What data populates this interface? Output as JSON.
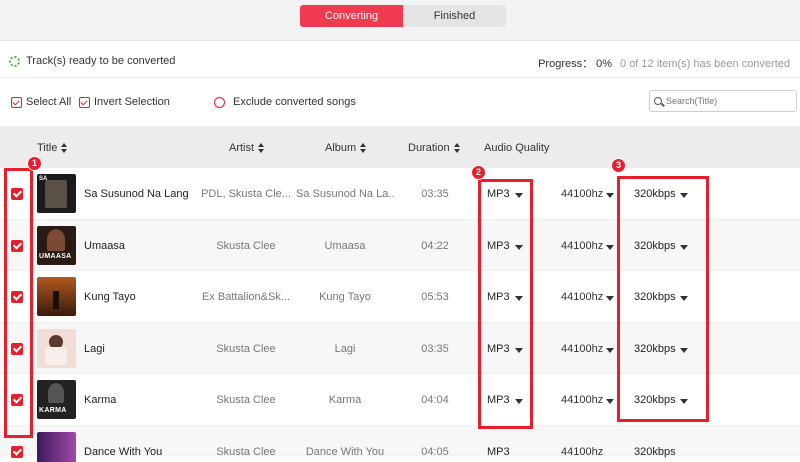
{
  "tabs": [
    {
      "label": "Converting",
      "active": true
    },
    {
      "label": "Finished",
      "active": false
    }
  ],
  "status": {
    "text": "Track(s) ready to be converted",
    "progress_label": "Progress：",
    "progress_value": "0%",
    "progress_count": "0 of 12 item(s) has been converted"
  },
  "toolbar": {
    "select_all": "Select All",
    "invert_selection": "Invert Selection",
    "exclude_converted": "Exclude converted songs",
    "search_placeholder": "Search(Title)"
  },
  "columns": {
    "title": "Title",
    "artist": "Artist",
    "album": "Album",
    "duration": "Duration",
    "audio_quality": "Audio Quality"
  },
  "annotations": [
    "1",
    "2",
    "3"
  ],
  "tracks": [
    {
      "title": "Sa Susunod Na Lang",
      "artist": "PDL, Skusta Cle...",
      "album": "Sa Susunod Na La...",
      "duration": "03:35",
      "format": "MP3",
      "sample_rate": "44100hz",
      "bitrate": "320kbps",
      "checked": true,
      "cover_text": "",
      "cover_bg": "#1b1b1b"
    },
    {
      "title": "Umaasa",
      "artist": "Skusta Clee",
      "album": "Umaasa",
      "duration": "04:22",
      "format": "MP3",
      "sample_rate": "44100hz",
      "bitrate": "320kbps",
      "checked": true,
      "cover_text": "UMAASA",
      "cover_bg": "#2a1a14"
    },
    {
      "title": "Kung Tayo",
      "artist": "Ex Battalion&Sk...",
      "album": "Kung Tayo",
      "duration": "05:53",
      "format": "MP3",
      "sample_rate": "44100hz",
      "bitrate": "320kbps",
      "checked": true,
      "cover_text": "",
      "cover_bg": "#6a3515"
    },
    {
      "title": "Lagi",
      "artist": "Skusta Clee",
      "album": "Lagi",
      "duration": "03:35",
      "format": "MP3",
      "sample_rate": "44100hz",
      "bitrate": "320kbps",
      "checked": true,
      "cover_text": "",
      "cover_bg": "#e8c9c4"
    },
    {
      "title": "Karma",
      "artist": "Skusta Clee",
      "album": "Karma",
      "duration": "04:04",
      "format": "MP3",
      "sample_rate": "44100hz",
      "bitrate": "320kbps",
      "checked": true,
      "cover_text": "KARMA",
      "cover_bg": "#222222"
    },
    {
      "title": "Dance With You",
      "artist": "Skusta Clee",
      "album": "Dance With You",
      "duration": "04:05",
      "format": "MP3",
      "sample_rate": "44100hz",
      "bitrate": "320kbps",
      "checked": true,
      "cover_text": "",
      "cover_bg": "#6b2c7a"
    }
  ],
  "colors": {
    "accent": "#f03a4f",
    "annotation": "#e4202f"
  }
}
